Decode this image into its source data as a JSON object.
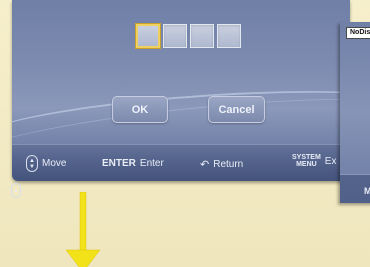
{
  "dialog": {
    "pin_boxes": 4,
    "ok_label": "OK",
    "cancel_label": "Cancel"
  },
  "footer": {
    "move_label": "Move",
    "enter_key": "ENTER",
    "enter_label": "Enter",
    "return_label": "Return",
    "system_menu_line1": "SYSTEM",
    "system_menu_line2": "MENU",
    "exit_label_partial": "Ex"
  },
  "second_screen": {
    "label": "NoDis",
    "footer_partial": "M"
  },
  "colors": {
    "background": "#f3ecc6",
    "panel": "#7d8bb0",
    "focus": "#f0d060",
    "arrow": "#f2e21a"
  }
}
